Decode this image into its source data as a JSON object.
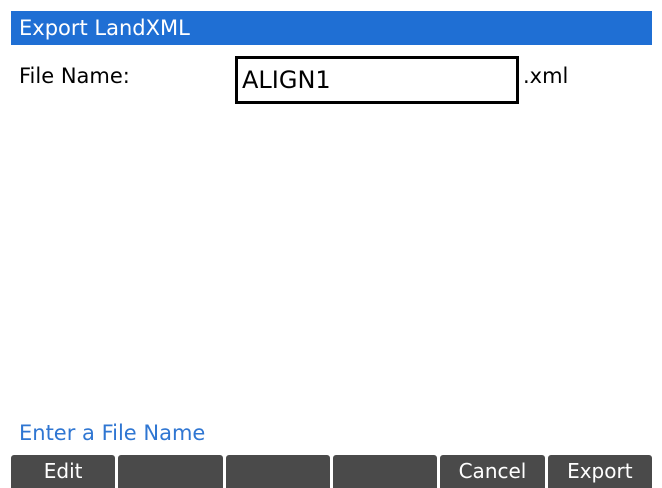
{
  "window": {
    "title": "Export LandXML"
  },
  "form": {
    "file_name_label": "File Name:",
    "file_name_value": "ALIGN1",
    "file_extension": ".xml"
  },
  "status": {
    "hint": "Enter a File Name"
  },
  "softkeys": [
    {
      "label": "Edit"
    },
    {
      "label": ""
    },
    {
      "label": ""
    },
    {
      "label": ""
    },
    {
      "label": "Cancel"
    },
    {
      "label": "Export"
    }
  ],
  "colors": {
    "title_bar": "#1f6fd4",
    "hint_text": "#2f76d2",
    "softkey_bg": "#4a4a4a"
  }
}
